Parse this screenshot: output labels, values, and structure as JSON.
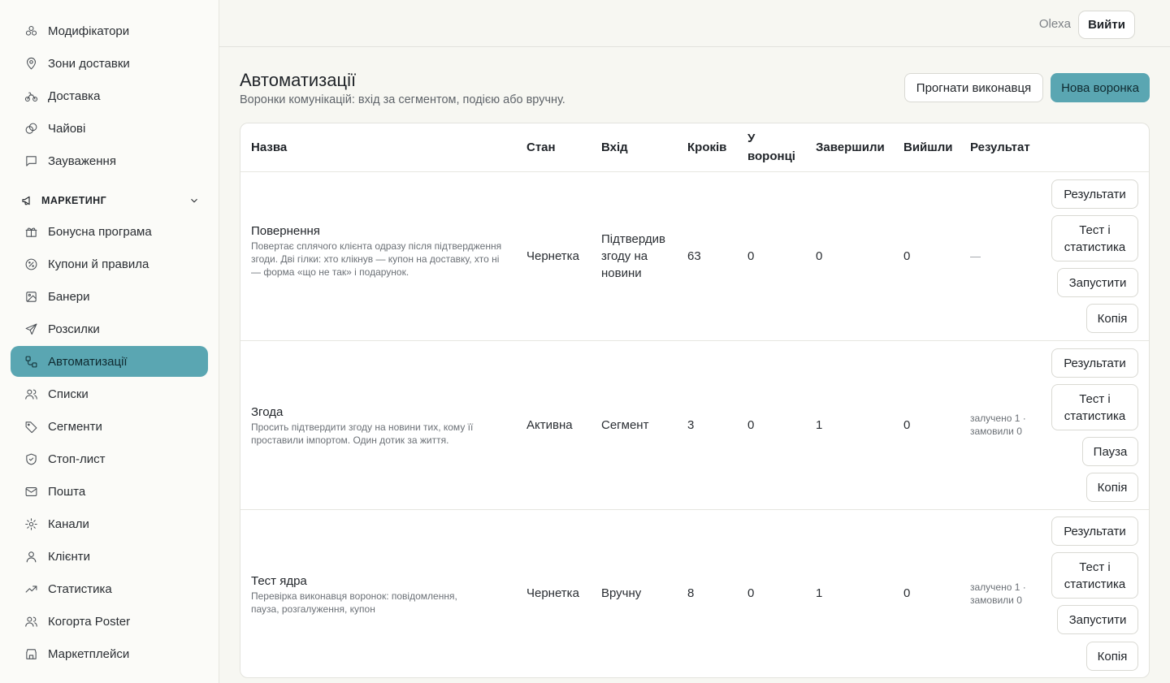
{
  "sidebar": {
    "items_top": [
      {
        "label": "Модифікатори",
        "icon": "modifiers-icon"
      },
      {
        "label": "Зони доставки",
        "icon": "map-pin-icon"
      },
      {
        "label": "Доставка",
        "icon": "bike-icon"
      },
      {
        "label": "Чайові",
        "icon": "coins-icon"
      },
      {
        "label": "Зауваження",
        "icon": "comment-icon"
      }
    ],
    "section": {
      "label": "МАРКЕТИНГ",
      "icon": "megaphone-icon"
    },
    "items_marketing": [
      {
        "label": "Бонусна програма",
        "icon": "gift-icon"
      },
      {
        "label": "Купони й правила",
        "icon": "coupon-icon"
      },
      {
        "label": "Банери",
        "icon": "image-icon"
      },
      {
        "label": "Розсилки",
        "icon": "send-icon"
      },
      {
        "label": "Автоматизації",
        "icon": "workflow-icon",
        "active": true
      },
      {
        "label": "Списки",
        "icon": "users-icon"
      },
      {
        "label": "Сегменти",
        "icon": "tag-icon"
      },
      {
        "label": "Стоп-лист",
        "icon": "shield-icon"
      },
      {
        "label": "Пошта",
        "icon": "mail-icon"
      },
      {
        "label": "Канали",
        "icon": "gear-icon"
      },
      {
        "label": "Клієнти",
        "icon": "user-icon"
      },
      {
        "label": "Статистика",
        "icon": "trend-icon"
      },
      {
        "label": "Когорта Poster",
        "icon": "users-icon"
      },
      {
        "label": "Маркетплейси",
        "icon": "store-icon"
      }
    ]
  },
  "topbar": {
    "user": "Olexa",
    "logout": "Вийти"
  },
  "header": {
    "title": "Автоматизації",
    "subtitle": "Воронки комунікацій: вхід за сегментом, подією або вручну.",
    "run_executor": "Прогнати виконавця",
    "new_funnel": "Нова воронка"
  },
  "table": {
    "columns": {
      "name": "Назва",
      "state": "Стан",
      "entry": "Вхід",
      "steps": "Кроків",
      "in_funnel": "У воронці",
      "completed": "Завершили",
      "exited": "Вийшли",
      "result": "Результат"
    },
    "rows": [
      {
        "name": "Повернення",
        "description": "Повертає сплячого клієнта одразу після підтвердження згоди. Дві гілки: хто клікнув — купон на доставку, хто ні — форма «що не так» і подарунок.",
        "state": "Чернетка",
        "entry": "Підтвердив згоду на новини",
        "steps": "63",
        "in_funnel": "0",
        "completed": "0",
        "exited": "0",
        "result": "—",
        "actions": [
          "Результати",
          "Тест і статистика",
          "Запустити",
          "Копія"
        ]
      },
      {
        "name": "Згода",
        "description": "Просить підтвердити згоду на новини тих, кому її проставили імпортом. Один дотик за життя.",
        "state": "Активна",
        "entry": "Сегмент",
        "steps": "3",
        "in_funnel": "0",
        "completed": "1",
        "exited": "0",
        "result": "залучено 1 · замовили 0",
        "actions": [
          "Результати",
          "Тест і статистика",
          "Пауза",
          "Копія"
        ]
      },
      {
        "name": "Тест ядра",
        "description": "Перевірка виконавця воронок: повідомлення, пауза, розгалуження, купон",
        "state": "Чернетка",
        "entry": "Вручну",
        "steps": "8",
        "in_funnel": "0",
        "completed": "1",
        "exited": "0",
        "result": "залучено 1 · замовили 0",
        "actions": [
          "Результати",
          "Тест і статистика",
          "Запустити",
          "Копія"
        ]
      }
    ]
  }
}
